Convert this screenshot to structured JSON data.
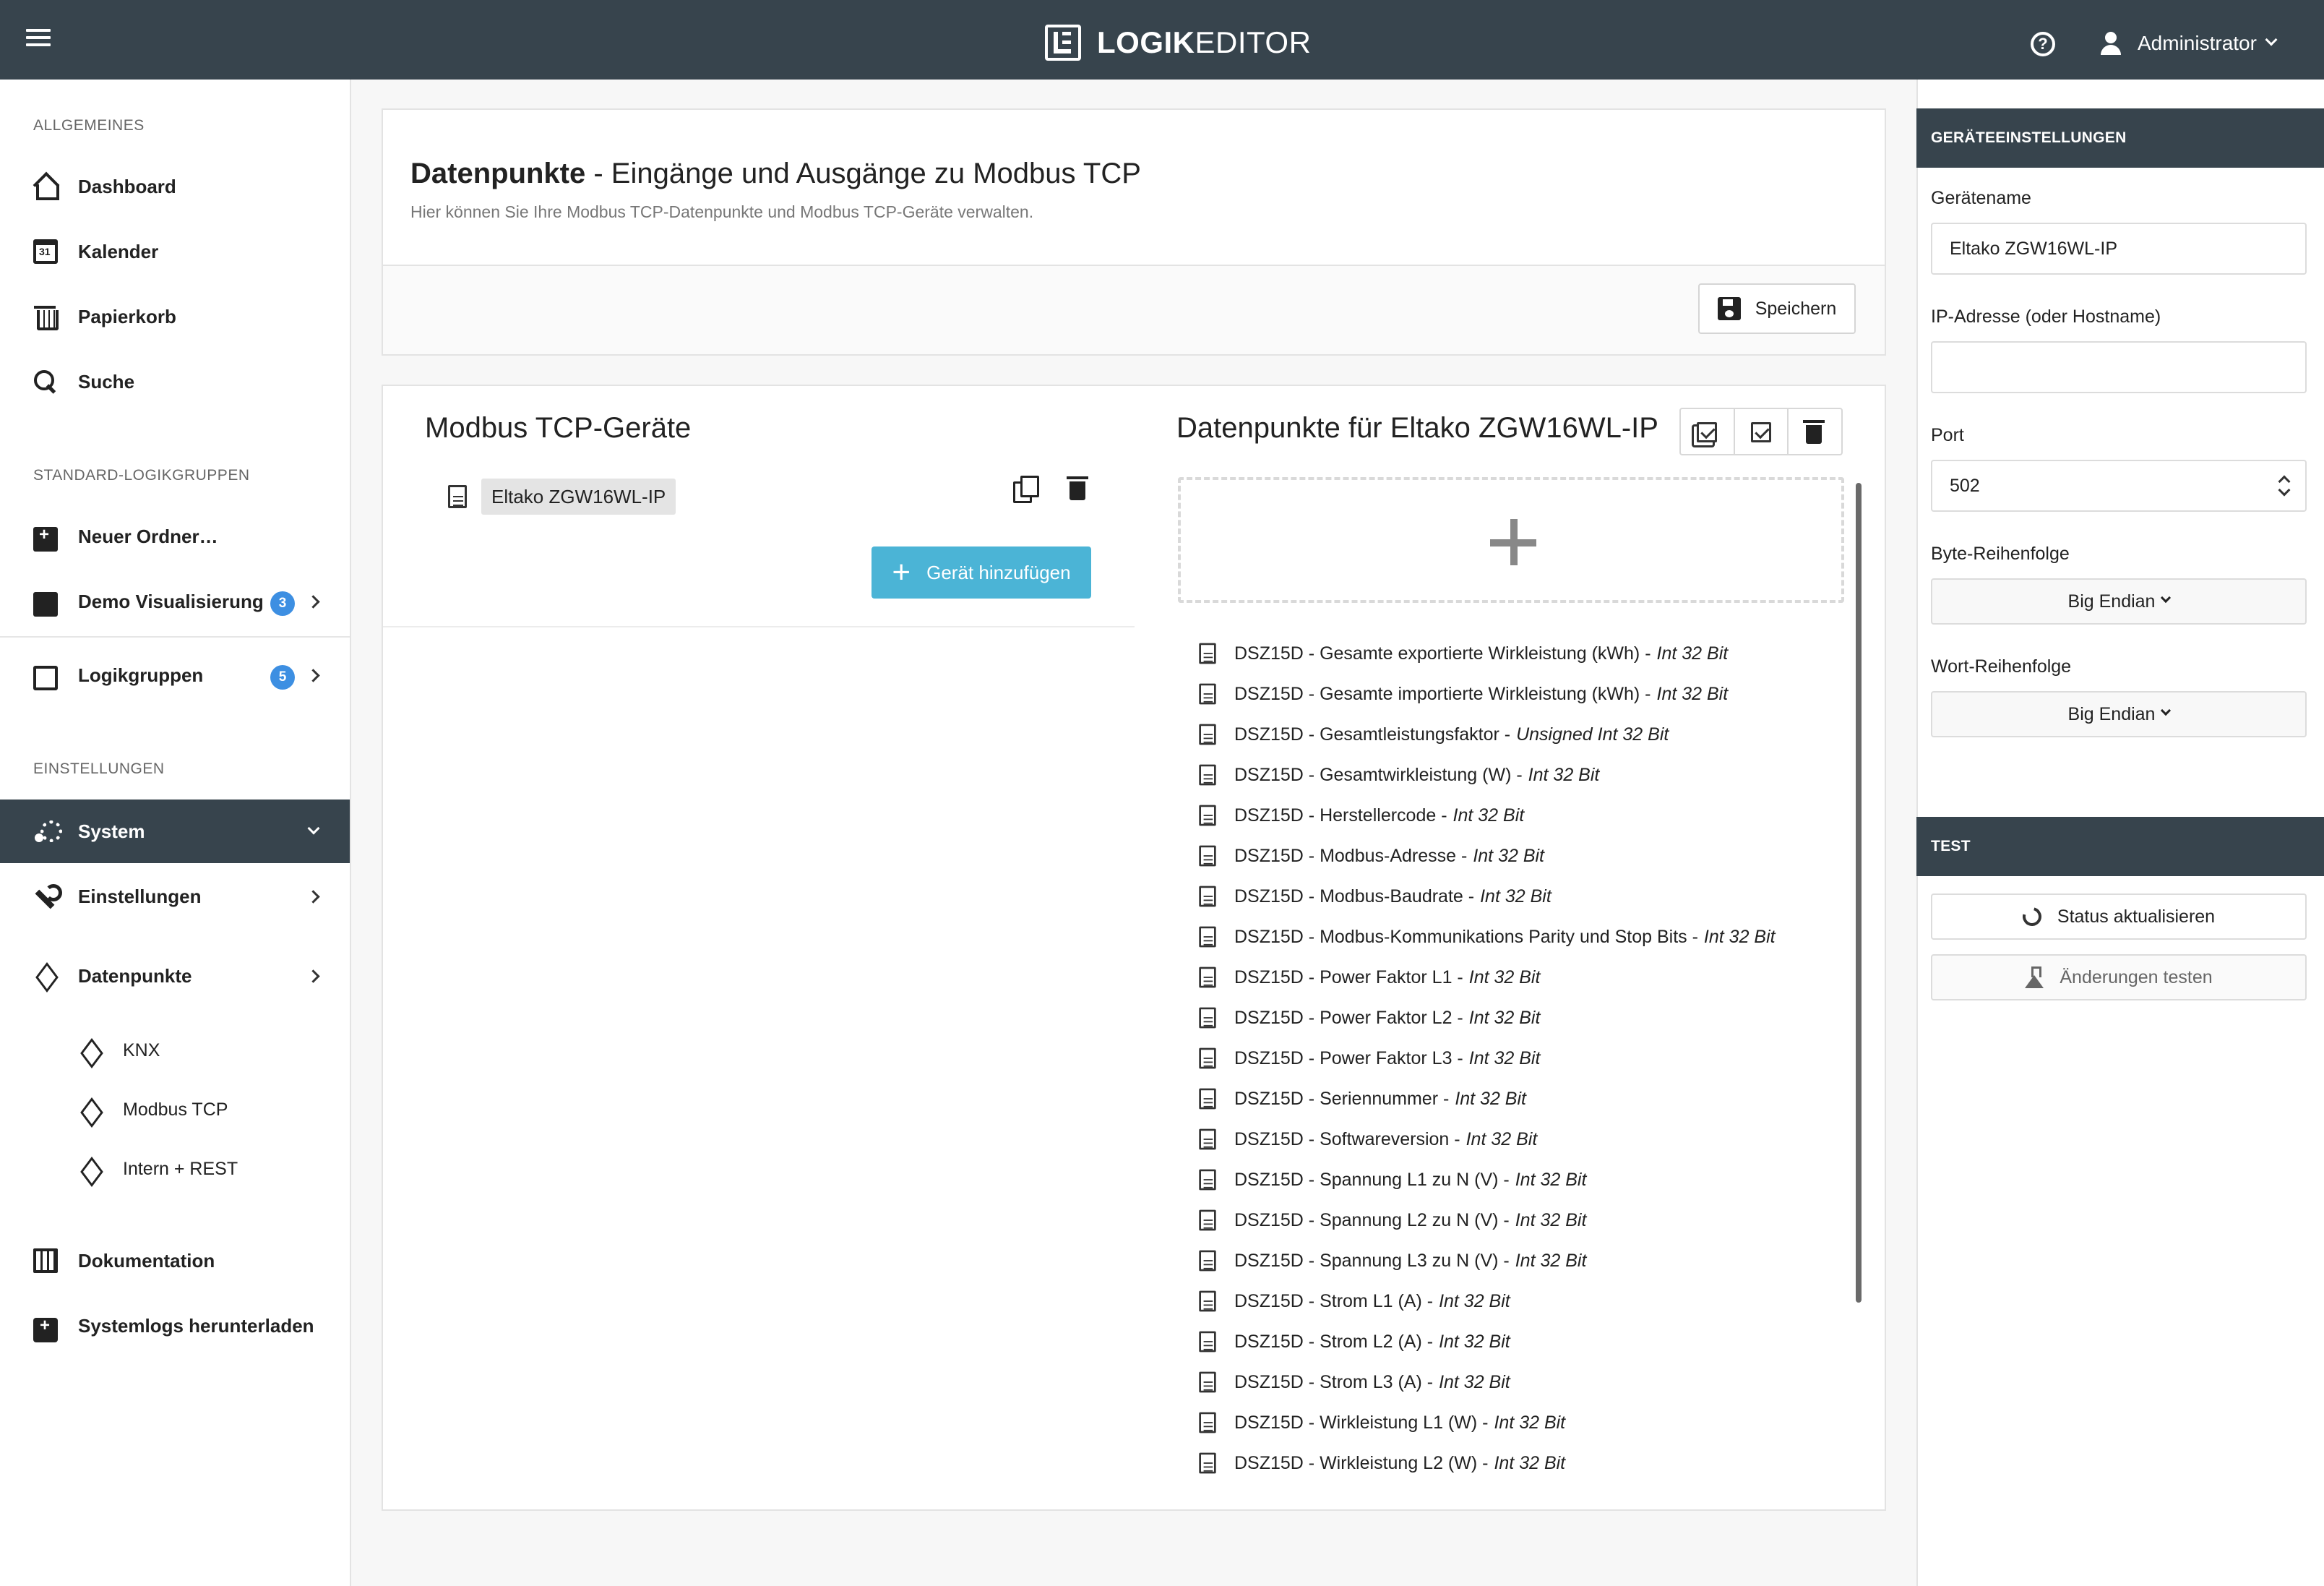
{
  "app": {
    "brand_bold": "LOGIK",
    "brand_rest": "EDITOR",
    "help": "?",
    "user": "Administrator"
  },
  "sidebar": {
    "sections": {
      "general": "ALLGEMEINES",
      "standard": "STANDARD-LOGIKGRUPPEN",
      "settings": "EINSTELLUNGEN"
    },
    "items": {
      "dashboard": "Dashboard",
      "calendar": "Kalender",
      "trash": "Papierkorb",
      "search": "Suche",
      "new_folder": "Neuer Ordner…",
      "demo": "Demo Visualisierung",
      "demo_badge": "3",
      "logic_groups": "Logikgruppen",
      "logic_groups_badge": "5",
      "system": "System",
      "settings": "Einstellungen",
      "datapoints": "Datenpunkte",
      "knx": "KNX",
      "modbus": "Modbus TCP",
      "intern": "Intern + REST",
      "docs": "Dokumentation",
      "logs": "Systemlogs herunterladen"
    }
  },
  "main": {
    "title_bold": "Datenpunkte",
    "title_rest": " - Eingänge und Ausgänge zu Modbus TCP",
    "subtitle": "Hier können Sie Ihre Modbus TCP-Datenpunkte und Modbus TCP-Geräte verwalten.",
    "save_label": "Speichern",
    "devices_heading": "Modbus TCP-Geräte",
    "device_name": "Eltako ZGW16WL-IP",
    "add_device_label": "Gerät hinzufügen",
    "datapoints_heading": "Datenpunkte für Eltako ZGW16WL-IP",
    "datapoints": [
      {
        "name": "DSZ15D - Gesamte exportierte Wirkleistung (kWh) -",
        "type": "Int 32 Bit"
      },
      {
        "name": "DSZ15D - Gesamte importierte Wirkleistung (kWh) -",
        "type": "Int 32 Bit"
      },
      {
        "name": "DSZ15D - Gesamtleistungsfaktor -",
        "type": "Unsigned Int 32 Bit"
      },
      {
        "name": "DSZ15D - Gesamtwirkleistung (W) -",
        "type": "Int 32 Bit"
      },
      {
        "name": "DSZ15D - Herstellercode -",
        "type": "Int 32 Bit"
      },
      {
        "name": "DSZ15D - Modbus-Adresse -",
        "type": "Int 32 Bit"
      },
      {
        "name": "DSZ15D - Modbus-Baudrate -",
        "type": "Int 32 Bit"
      },
      {
        "name": "DSZ15D - Modbus-Kommunikations Parity und Stop Bits -",
        "type": "Int 32 Bit"
      },
      {
        "name": "DSZ15D - Power Faktor L1 -",
        "type": "Int 32 Bit"
      },
      {
        "name": "DSZ15D - Power Faktor L2 -",
        "type": "Int 32 Bit"
      },
      {
        "name": "DSZ15D - Power Faktor L3 -",
        "type": "Int 32 Bit"
      },
      {
        "name": "DSZ15D - Seriennummer -",
        "type": "Int 32 Bit"
      },
      {
        "name": "DSZ15D - Softwareversion -",
        "type": "Int 32 Bit"
      },
      {
        "name": "DSZ15D - Spannung L1 zu N (V) -",
        "type": "Int 32 Bit"
      },
      {
        "name": "DSZ15D - Spannung L2 zu N (V) -",
        "type": "Int 32 Bit"
      },
      {
        "name": "DSZ15D - Spannung L3 zu N (V) -",
        "type": "Int 32 Bit"
      },
      {
        "name": "DSZ15D - Strom L1 (A) -",
        "type": "Int 32 Bit"
      },
      {
        "name": "DSZ15D - Strom L2 (A) -",
        "type": "Int 32 Bit"
      },
      {
        "name": "DSZ15D - Strom L3 (A) -",
        "type": "Int 32 Bit"
      },
      {
        "name": "DSZ15D - Wirkleistung L1 (W) -",
        "type": "Int 32 Bit"
      },
      {
        "name": "DSZ15D - Wirkleistung L2 (W) -",
        "type": "Int 32 Bit"
      }
    ]
  },
  "device_settings": {
    "heading": "GERÄTEEINSTELLUNGEN",
    "name_label": "Gerätename",
    "name_value": "Eltako ZGW16WL-IP",
    "ip_label": "IP-Adresse (oder Hostname)",
    "ip_value": "",
    "port_label": "Port",
    "port_value": "502",
    "byte_order_label": "Byte-Reihenfolge",
    "byte_order_value": "Big Endian",
    "word_order_label": "Wort-Reihenfolge",
    "word_order_value": "Big Endian"
  },
  "test": {
    "heading": "TEST",
    "refresh_label": "Status aktualisieren",
    "test_label": "Änderungen testen"
  }
}
